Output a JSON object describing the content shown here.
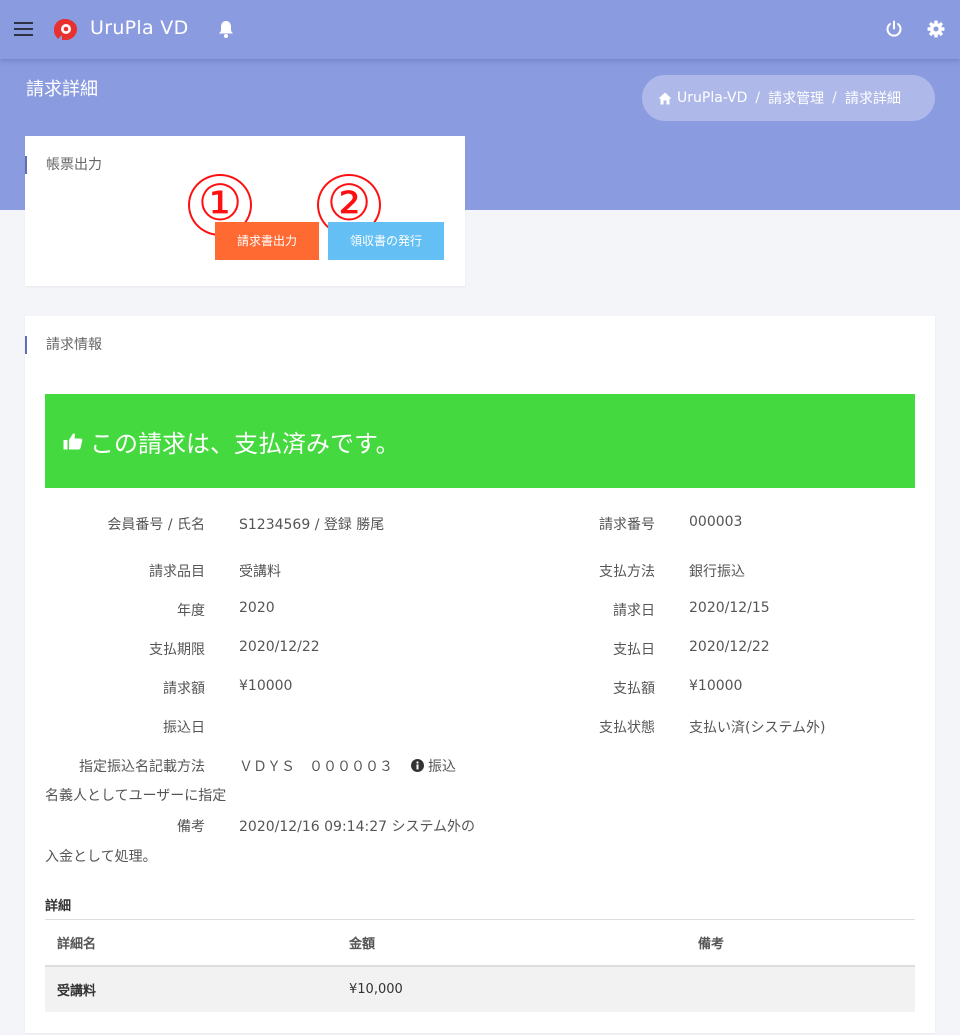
{
  "app": {
    "name": "UruPla VD"
  },
  "header": {
    "page_title": "請求詳細",
    "breadcrumb": [
      "UruPla-VD",
      "請求管理",
      "請求詳細"
    ]
  },
  "output_card": {
    "title": "帳票出力",
    "invoice_button": "請求書出力",
    "receipt_button": "領収書の発行",
    "marker_1": "①",
    "marker_2": "②"
  },
  "info_card": {
    "title": "請求情報",
    "paid_message": "この請求は、支払済みです。",
    "left_rows": [
      {
        "label": "会員番号 / 氏名",
        "value": "S1234569 / 登録 勝尾"
      },
      {
        "label": "請求品目",
        "value": "受講料"
      },
      {
        "label": "年度",
        "value": "2020"
      },
      {
        "label": "支払期限",
        "value": "2020/12/22"
      },
      {
        "label": "請求額",
        "value": "¥10000"
      },
      {
        "label": "振込日",
        "value": ""
      }
    ],
    "right_rows": [
      {
        "label": "請求番号",
        "value": "000003"
      },
      {
        "label": "支払方法",
        "value": "銀行振込"
      },
      {
        "label": "請求日",
        "value": "2020/12/15"
      },
      {
        "label": "支払日",
        "value": "2020/12/22"
      },
      {
        "label": "支払額",
        "value": "¥10000"
      },
      {
        "label": "支払状態",
        "value": "支払い済(システム外)"
      }
    ],
    "transfer_name": {
      "label": "指定振込名記載方法",
      "value": "ＶＤＹＳ　０００００３",
      "note_line1": "振込",
      "note_line2": "名義人としてユーザーに指定"
    },
    "remarks": {
      "label": "備考",
      "line1": "2020/12/16 09:14:27 システム外の",
      "line2": "入金として処理。"
    }
  },
  "details": {
    "section_title": "詳細",
    "columns": [
      "詳細名",
      "金額",
      "備考"
    ],
    "rows": [
      {
        "name": "受講料",
        "amount": "¥10,000",
        "note": ""
      }
    ]
  },
  "colors": {
    "header_bg": "#8b9be0",
    "invoice_button": "#ff6a33",
    "receipt_button": "#63bff4",
    "paid_banner": "#44d93e",
    "marker": "#ff1010"
  }
}
